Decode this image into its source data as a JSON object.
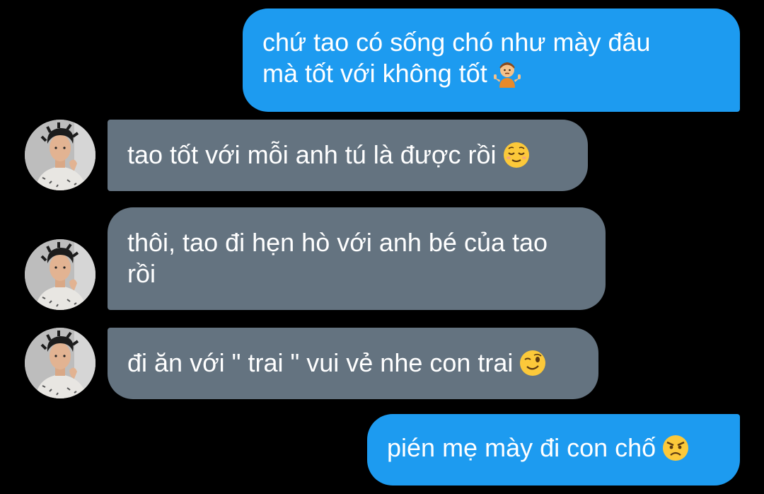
{
  "messages": [
    {
      "direction": "sent",
      "lines": [
        "chứ tao có sống chó như mày đâu",
        "mà tốt với không tốt"
      ],
      "emoji": "person-shrugging"
    },
    {
      "direction": "received",
      "lines": [
        "tao tốt với mỗi anh tú là được rồi"
      ],
      "emoji": "relieved-face"
    },
    {
      "direction": "received",
      "lines": [
        "thôi, tao đi hẹn hò với anh bé của tao",
        "rồi"
      ],
      "emoji": ""
    },
    {
      "direction": "received",
      "lines": [
        "đi ăn với \" trai \" vui vẻ nhe con trai"
      ],
      "emoji": "winking-face"
    },
    {
      "direction": "sent",
      "lines": [
        "pién mẹ mày đi con chố"
      ],
      "emoji": "angry-face"
    }
  ],
  "colors": {
    "background": "#000000",
    "sent_bubble": "#1d9bf0",
    "received_bubble": "#647380",
    "text": "#ffffff"
  },
  "icons": {
    "avatar": "contact-avatar-photo"
  }
}
